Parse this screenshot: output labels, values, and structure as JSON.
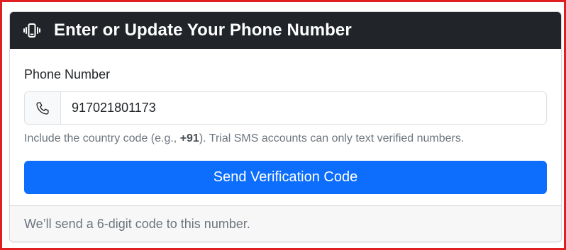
{
  "header": {
    "icon": "phone-vibrate-icon",
    "title": "Enter or Update Your Phone Number"
  },
  "form": {
    "phone_label": "Phone Number",
    "phone_icon": "phone-icon",
    "phone_value": "917021801173",
    "help_prefix": "Include the country code (e.g., ",
    "help_code": "+91",
    "help_suffix": "). Trial SMS accounts can only text verified numbers.",
    "submit_label": "Send Verification Code"
  },
  "footer": {
    "text": "We’ll send a 6-digit code to this number."
  },
  "colors": {
    "header_bg": "#212529",
    "primary": "#0d6efd",
    "outline": "#e02020"
  }
}
